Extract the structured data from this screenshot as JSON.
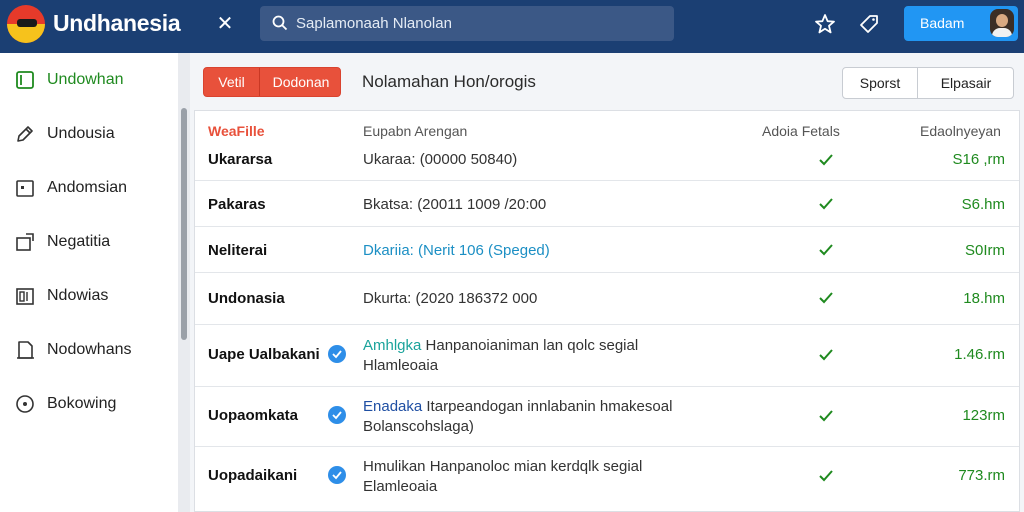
{
  "app": {
    "title": "Undhanesia"
  },
  "search": {
    "placeholder": "Saplamonaah Nlanolan"
  },
  "header": {
    "primary_button": "Badam",
    "icons": [
      "close-icon",
      "search-icon",
      "star-icon",
      "tag-icon",
      "user-avatar"
    ]
  },
  "sidebar": {
    "items": [
      {
        "label": "Undowhan",
        "icon": "checkbox-icon",
        "active": true
      },
      {
        "label": "Undousia",
        "icon": "pencil-icon",
        "active": false
      },
      {
        "label": "Andomsian",
        "icon": "folder-icon",
        "active": false
      },
      {
        "label": "Negatitia",
        "icon": "share-icon",
        "active": false
      },
      {
        "label": "Ndowias",
        "icon": "columns-icon",
        "active": false
      },
      {
        "label": "Nodowhans",
        "icon": "document-icon",
        "active": false
      },
      {
        "label": "Bokowing",
        "icon": "circle-icon",
        "active": false
      }
    ]
  },
  "toolbar": {
    "segment": [
      "Vetil",
      "Dodonan"
    ],
    "title": "Nolamahan Hon/orogis",
    "buttons": [
      "Sporst",
      "Elpasair"
    ]
  },
  "table": {
    "headers": [
      "WeaFille",
      "Eupabn Arengan",
      "Adoia Fetals",
      "Edaolnyeyan"
    ],
    "rows": [
      {
        "name": "Ukararsa",
        "desc": "Ukaraa: (00000 50840)",
        "checked": true,
        "value": "S16 ,rm"
      },
      {
        "name": "Pakaras",
        "desc": "Bkatsa: (20011 1009 /20:00",
        "checked": true,
        "value": "S6.hm"
      },
      {
        "name": "Neliterai",
        "desc": "Dkariia: (Nerit 106 (Speged)",
        "checked": true,
        "value": "S0Irm"
      },
      {
        "name": "Undonasia",
        "desc": "Dkurta: (2020 186372 000",
        "checked": true,
        "value": "18.hm"
      },
      {
        "name": "Uape Ualbakani",
        "desc_lead": "Amhlgka",
        "desc": "Hanpanoianiman lan qolc segial",
        "desc2": "Hlamleoaia",
        "checked": true,
        "value": "1.46.rm",
        "badge": true
      },
      {
        "name": "Uopaomkata",
        "desc_lead": "Enadaka",
        "desc": "Itarpeandogan innlabanin hmakesoal",
        "desc2": "Bolanscohslaga)",
        "checked": true,
        "value": "123rm",
        "badge": true
      },
      {
        "name": "Uopadaikani",
        "desc_lead": "Hmulikan",
        "desc": "Hanpanoloc mian kerdqlk segial",
        "desc2": "Elamleoaia",
        "checked": true,
        "value": "773.rm",
        "badge": true
      }
    ]
  },
  "colors": {
    "topbar": "#1b3f73",
    "accent_orange": "#e8513b",
    "accent_blue": "#2196f3",
    "success_green": "#1f8a1f"
  }
}
